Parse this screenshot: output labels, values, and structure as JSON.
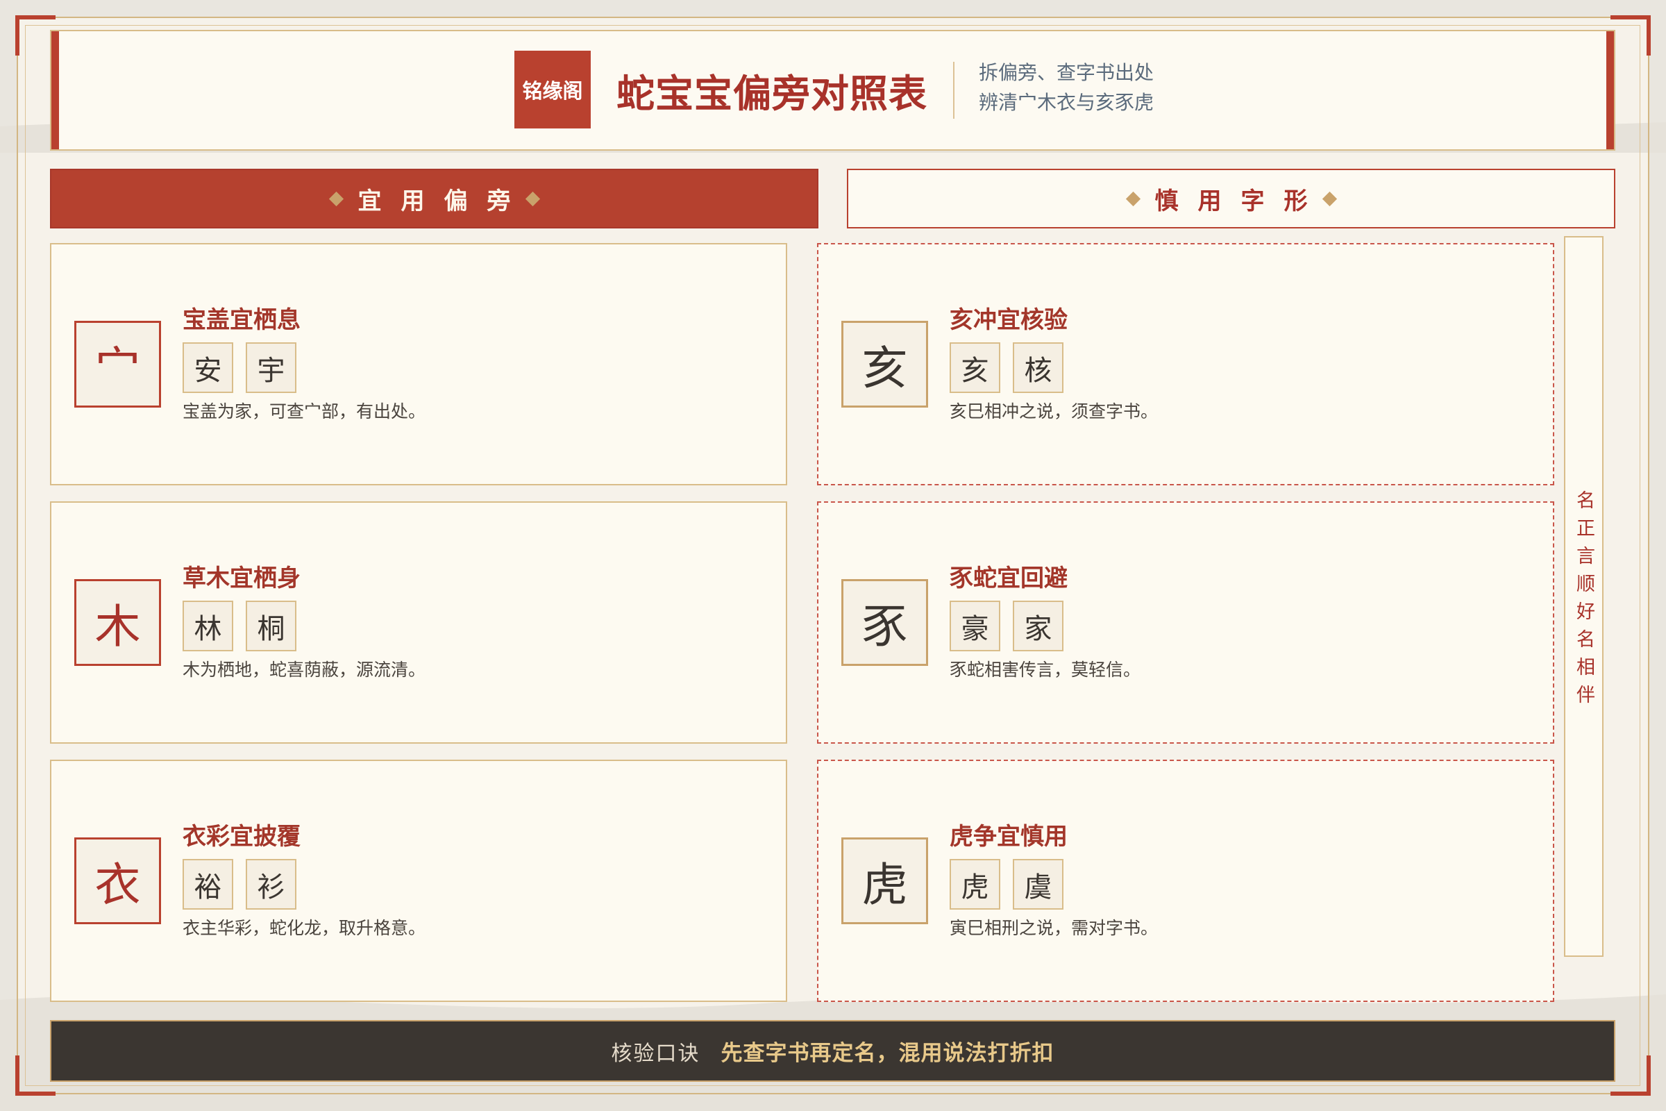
{
  "brand": {
    "logo_text": "铭缘阁"
  },
  "header": {
    "title": "蛇宝宝偏旁对照表",
    "subtitle_lines": [
      "拆偏旁、查字书出处",
      "辨清宀木衣与亥豕虎"
    ]
  },
  "sections": {
    "recommended": {
      "label": "宜用偏旁",
      "cards": [
        {
          "radical": "宀",
          "title": "宝盖宜栖息",
          "examples": [
            "安",
            "宇"
          ],
          "description": "宝盖为家，可查宀部，有出处。"
        },
        {
          "radical": "木",
          "title": "草木宜栖身",
          "examples": [
            "林",
            "桐"
          ],
          "description": "木为栖地，蛇喜荫蔽，源流清。"
        },
        {
          "radical": "衣",
          "title": "衣彩宜披覆",
          "examples": [
            "裕",
            "衫"
          ],
          "description": "衣主华彩，蛇化龙，取升格意。"
        }
      ]
    },
    "caution": {
      "label": "慎用字形",
      "cards": [
        {
          "radical": "亥",
          "title": "亥冲宜核验",
          "examples": [
            "亥",
            "核"
          ],
          "description": "亥巳相冲之说，须查字书。"
        },
        {
          "radical": "豕",
          "title": "豕蛇宜回避",
          "examples": [
            "豪",
            "家"
          ],
          "description": "豕蛇相害传言，莫轻信。"
        },
        {
          "radical": "虎",
          "title": "虎争宜慎用",
          "examples": [
            "虎",
            "虞"
          ],
          "description": "寅巳相刑之说，需对字书。"
        }
      ]
    }
  },
  "side_note": "名正言顺好名相伴",
  "footer": {
    "label": "核验口诀",
    "motto": "先查字书再定名，混用说法打折扣"
  },
  "icons": {
    "section_marker": "diamond-icon"
  },
  "colors": {
    "primary_red": "#b9412f",
    "gold": "#c9a26b",
    "paper": "#fdfaf1",
    "ink": "#3a3530",
    "subtitle": "#5b6b7c",
    "footer_bg": "#3b3631",
    "footer_accent": "#e8c98a"
  }
}
